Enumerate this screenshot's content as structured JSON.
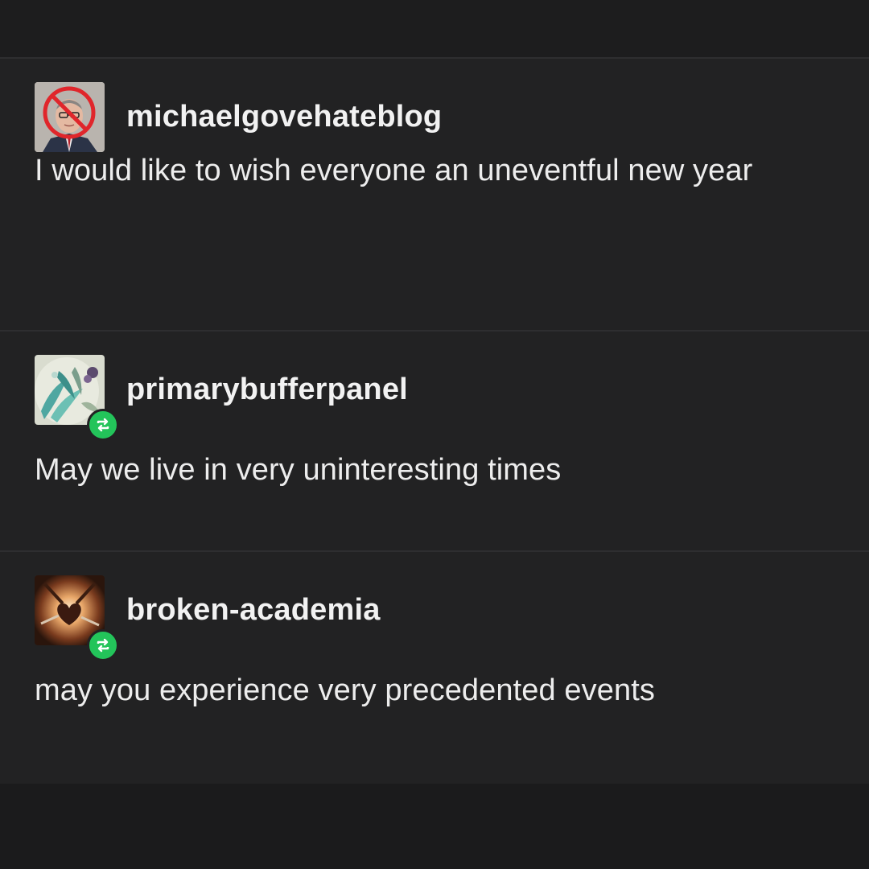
{
  "posts": [
    {
      "username": "michaelgovehateblog",
      "body": "I would like to wish everyone an uneventful new year",
      "avatar_icon": "crossed-out-portrait-avatar",
      "is_reblog": false
    },
    {
      "username": "primarybufferpanel",
      "body": "May we live in very uninteresting times",
      "avatar_icon": "floral-art-avatar",
      "is_reblog": true
    },
    {
      "username": "broken-academia",
      "body": "may you experience very precedented events",
      "avatar_icon": "heart-art-avatar",
      "is_reblog": true
    }
  ],
  "colors": {
    "background": "#1e1e1f",
    "post_background": "#222223",
    "divider": "#2e2e30",
    "text": "#ededed",
    "reblog_badge": "#23c45a",
    "prohibit_red": "#e0262b"
  }
}
